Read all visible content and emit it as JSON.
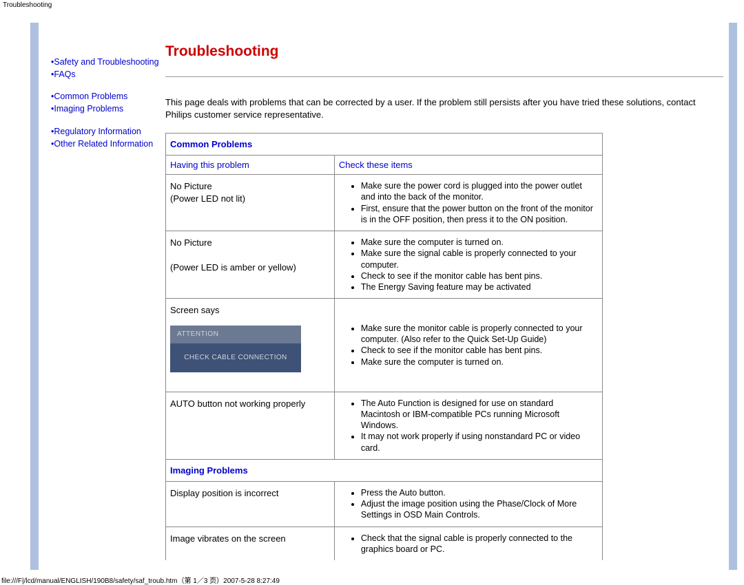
{
  "top_label": "Troubleshooting",
  "sidebar": {
    "items": [
      {
        "label": "Safety and Troubleshooting"
      },
      {
        "label": "FAQs"
      },
      {
        "label": "Common Problems"
      },
      {
        "label": "Imaging Problems"
      },
      {
        "label": "Regulatory Information"
      },
      {
        "label": "Other Related Information"
      }
    ]
  },
  "heading": "Troubleshooting",
  "intro": "This page deals with problems that can be corrected by a user. If the problem still persists after you have tried these solutions, contact Philips customer service representative.",
  "sections": {
    "common": {
      "title": "Common Problems",
      "col_left": "Having this problem",
      "col_right": "Check these items",
      "rows": [
        {
          "problem_line1": "No Picture",
          "problem_line2": "(Power LED not lit)",
          "checks": [
            "Make sure the power cord is plugged into the power outlet and into the back of the monitor.",
            "First, ensure that the power button on the front of the monitor is in the OFF position, then press it to the ON position."
          ]
        },
        {
          "problem_line1": "No Picture",
          "problem_line2": "",
          "problem_line3": "(Power LED is amber or yellow)",
          "checks": [
            "Make sure the computer is turned on.",
            "Make sure the signal cable is properly connected to your computer.",
            "Check to see if the monitor cable has bent pins.",
            "The Energy Saving feature may be activated"
          ]
        },
        {
          "problem_line1": "Screen says",
          "attention_title": "ATTENTION",
          "attention_body": "CHECK CABLE CONNECTION",
          "checks": [
            "Make sure the monitor cable is properly connected to your computer. (Also refer to the Quick Set-Up Guide)",
            "Check to see if the monitor cable has bent pins.",
            "Make sure the computer is turned on."
          ]
        },
        {
          "problem_line1": "AUTO button not working properly",
          "checks": [
            "The Auto Function is designed for use on standard Macintosh or IBM-compatible PCs running Microsoft Windows.",
            "It may not work properly if using nonstandard PC or video card."
          ]
        }
      ]
    },
    "imaging": {
      "title": "Imaging Problems",
      "rows": [
        {
          "problem_line1": "Display position is incorrect",
          "checks": [
            "Press the Auto button.",
            "Adjust the image position using the Phase/Clock of More Settings in OSD Main Controls."
          ]
        },
        {
          "problem_line1": "Image vibrates on the screen",
          "checks": [
            "Check that the signal cable is properly connected to the graphics board or PC."
          ]
        }
      ]
    }
  },
  "footer": "file:///F|/lcd/manual/ENGLISH/190B8/safety/saf_troub.htm（第 1／3 页）2007-5-28 8:27:49"
}
